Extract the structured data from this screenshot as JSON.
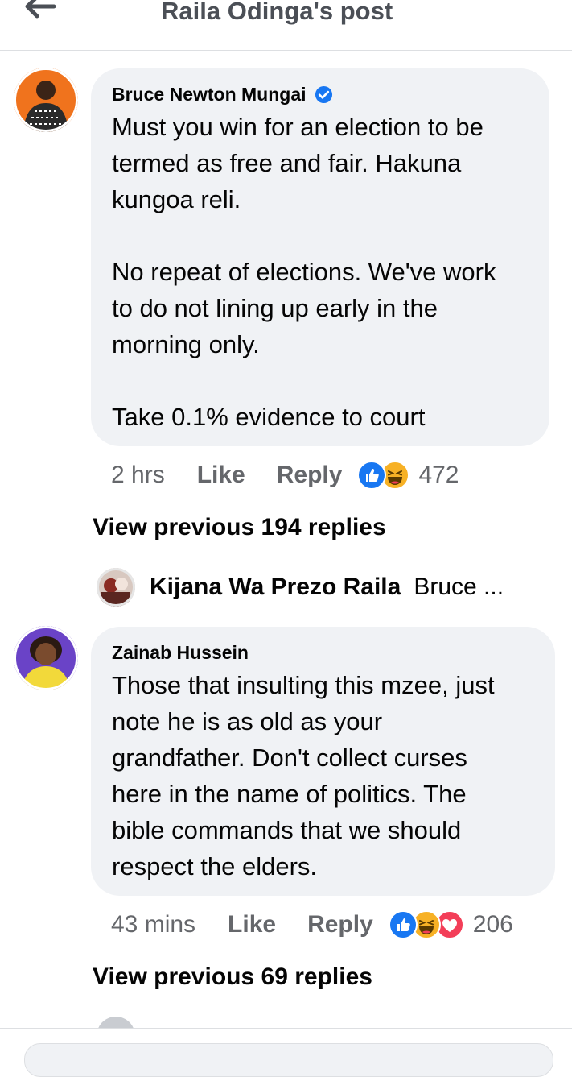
{
  "header": {
    "title": "Raila Odinga's post",
    "back_icon": "arrow-left-icon"
  },
  "comments": [
    {
      "author": "Bruce Newton Mungai",
      "verified": true,
      "text": "Must you win for an election to be\ntermed as free and fair. Hakuna\nkungoa reli.\n\nNo repeat of elections. We've work\nto do not lining up early in the\nmorning only.\n\nTake 0.1% evidence to court",
      "time": "2 hrs",
      "like_label": "Like",
      "reply_label": "Reply",
      "reactions": [
        "like",
        "haha"
      ],
      "reaction_count": "472",
      "view_previous": "View previous 194 replies",
      "latest_reply": {
        "name": "Kijana Wa Prezo Raila",
        "snippet": "Bruce ..."
      }
    },
    {
      "author": "Zainab Hussein",
      "verified": false,
      "text": "Those that insulting this mzee, just\nnote he is as old as your\ngrandfather. Don't collect curses\nhere in the name of politics. The\nbible commands that we should\nrespect the elders.",
      "time": "43 mins",
      "like_label": "Like",
      "reply_label": "Reply",
      "reactions": [
        "like",
        "haha",
        "love"
      ],
      "reaction_count": "206",
      "view_previous": "View previous 69 replies"
    }
  ],
  "colors": {
    "background": "#ffffff",
    "bubble": "#f0f2f5",
    "secondary_text": "#65676b",
    "primary_text": "#050505",
    "like_blue": "#1877f2",
    "haha_yellow": "#f7b125",
    "love_red": "#f33e58",
    "header_text": "#4b4f56"
  }
}
